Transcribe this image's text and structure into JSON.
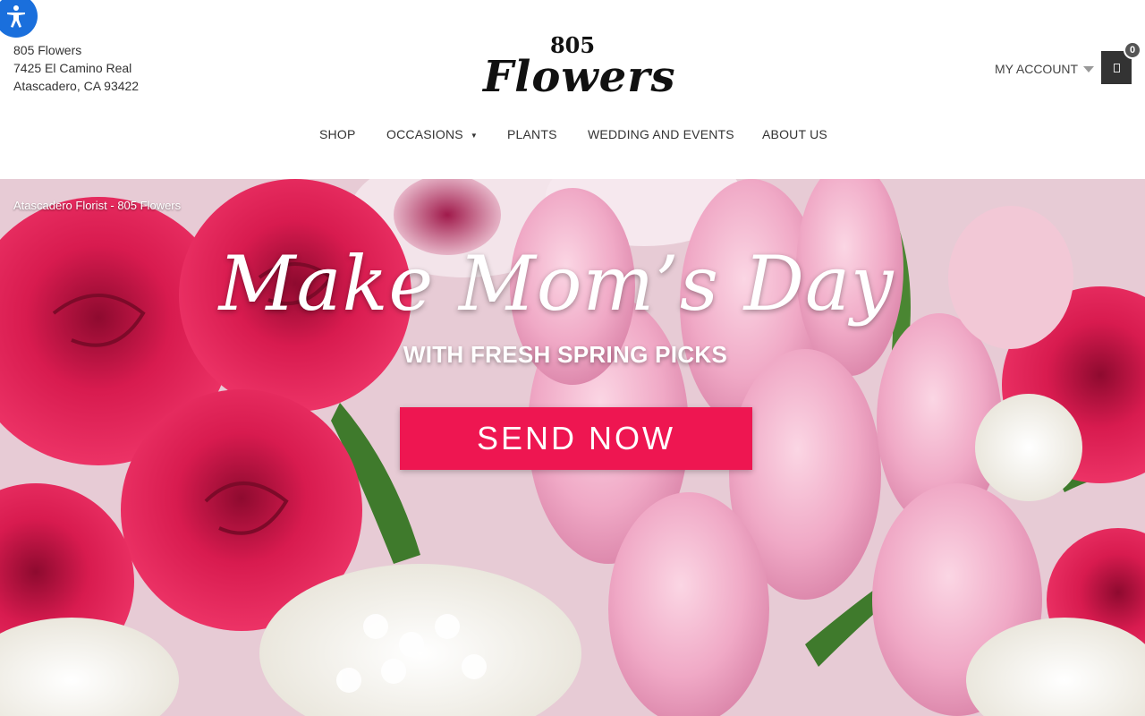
{
  "store": {
    "name": "805 Flowers",
    "address_line1": "7425 El Camino Real",
    "address_line2": "Atascadero, CA 93422"
  },
  "logo": {
    "number": "805",
    "word": "Flowers"
  },
  "header": {
    "account_label": "MY ACCOUNT",
    "cart_count": "0"
  },
  "nav": {
    "items": [
      {
        "label": "SHOP"
      },
      {
        "label": "OCCASIONS",
        "has_dropdown": true,
        "dropdown_glyph": "▼"
      },
      {
        "label": "PLANTS"
      },
      {
        "label": "WEDDING AND EVENTS"
      },
      {
        "label": "ABOUT US"
      }
    ]
  },
  "hero": {
    "breadcrumb": "Atascadero Florist - 805 Flowers",
    "headline": "Make Mom’s Day",
    "subheadline": "WITH FRESH SPRING PICKS",
    "cta_label": "SEND NOW"
  },
  "colors": {
    "cta": "#ee1651",
    "cart": "#333333",
    "accessibility": "#1a6fdc",
    "rose": "#d81b4f",
    "tulip": "#f0a9c6",
    "hydrangea": "#f4f1ea"
  },
  "icons": {
    "accessibility": "accessibility-icon",
    "cart": "shopping-bag-icon",
    "account_caret": "chevron-down-icon"
  }
}
